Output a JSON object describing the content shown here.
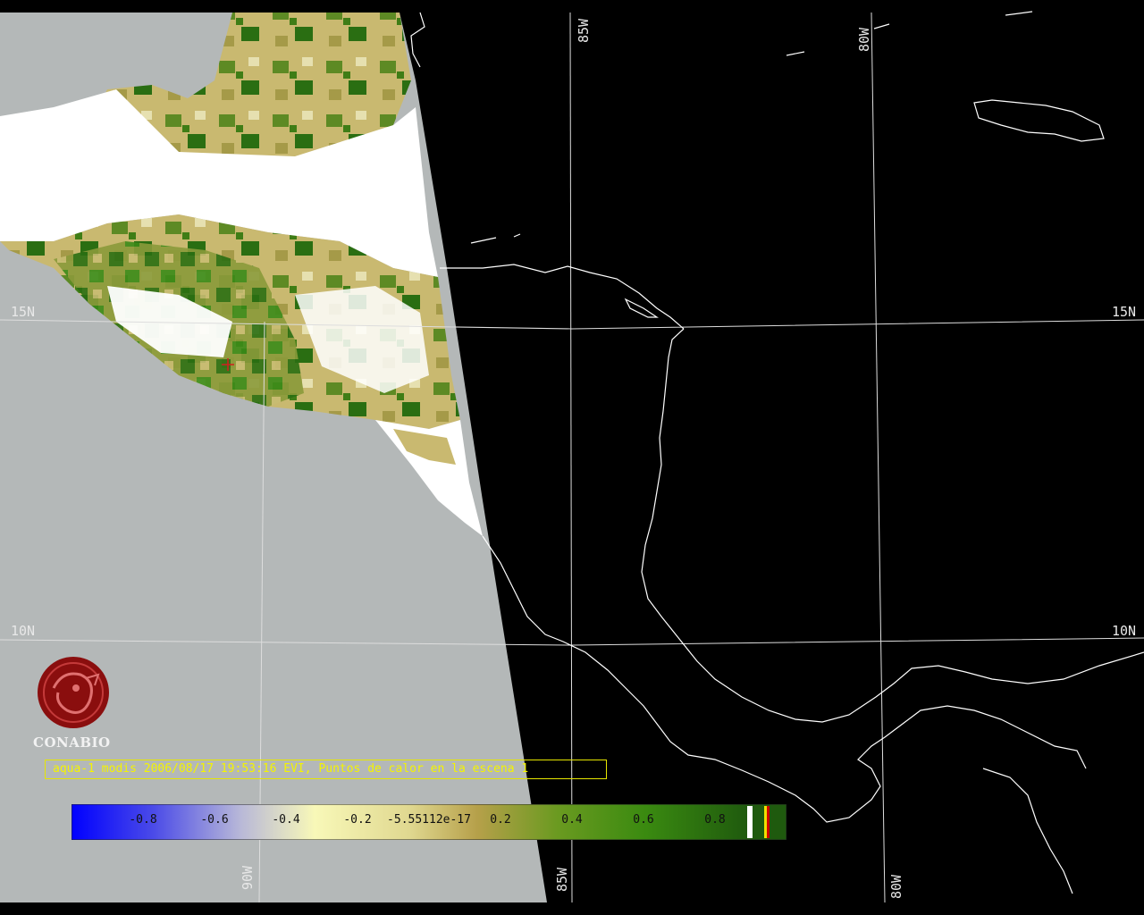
{
  "map": {
    "grid_labels": {
      "lat_15_left": "15N",
      "lat_15_right": "15N",
      "lat_10_left": "10N",
      "lat_10_right": "10N",
      "lon_85_top": "85W",
      "lon_80_top": "80W",
      "lon_90_bottom": "90W",
      "lon_85_bottom": "85W",
      "lon_80_bottom": "80W"
    },
    "colors": {
      "swath_gray": "#b4b8b8",
      "cloud_white": "#ffffff",
      "veg_dark_green": "#2a6e12",
      "veg_olive": "#b6a85a",
      "grid": "#dddddd",
      "coast": "#ffffff"
    }
  },
  "logo": {
    "name": "CONABIO"
  },
  "caption": {
    "text": "aqua-1 modis 2006/08/17 19:53:16 EVI, Puntos de calor en la escena 1"
  },
  "colorbar": {
    "labels": [
      "-0.8",
      "-0.6",
      "-0.4",
      "-0.2",
      "-5.55112e-17",
      "0.2",
      "0.4",
      "0.6",
      "0.8"
    ],
    "gradient_colors": [
      "#0000ff",
      "#5a5ae8",
      "#b8b8d8",
      "#f8f8b8",
      "#e0d890",
      "#b6a04a",
      "#6a9a20",
      "#3a8a10",
      "#1f5a0e"
    ]
  }
}
